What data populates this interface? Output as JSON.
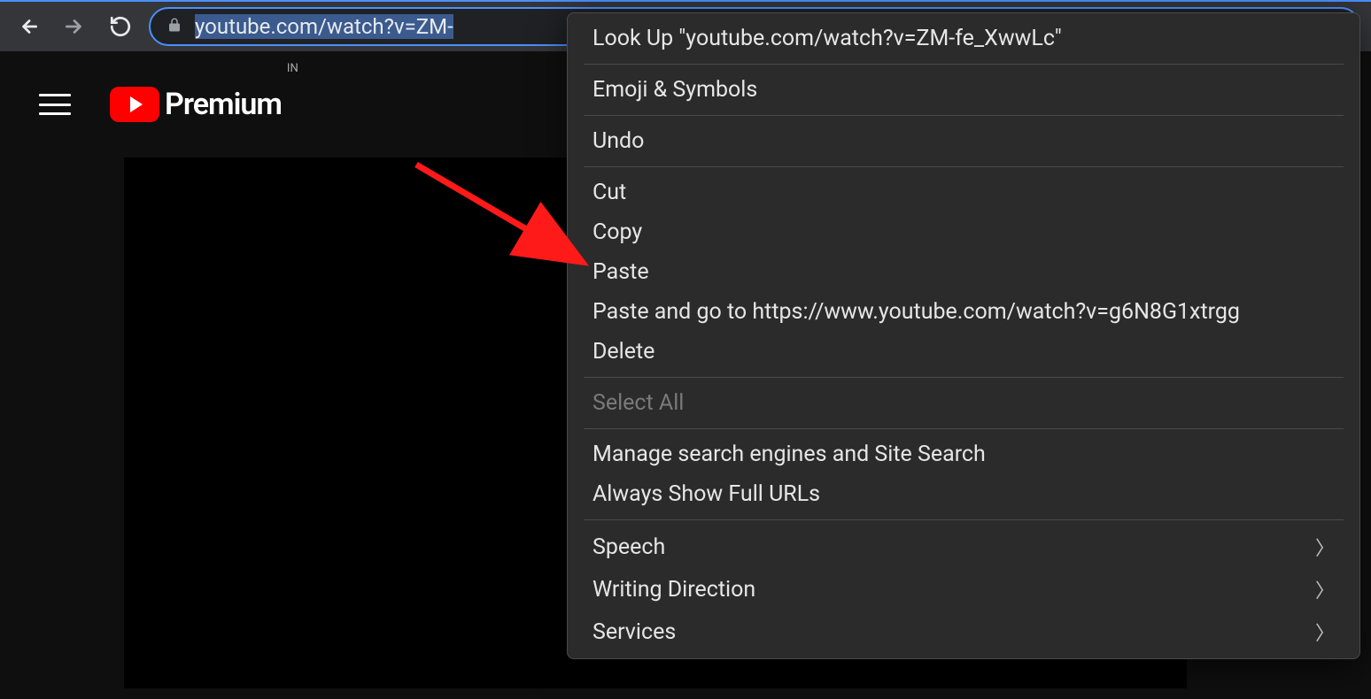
{
  "toolbar": {
    "url_display": "youtube.com/watch?v=ZM-"
  },
  "youtube": {
    "brand_text": "Premium",
    "region": "IN"
  },
  "context_menu": {
    "lookup": "Look Up \"youtube.com/watch?v=ZM-fe_XwwLc\"",
    "emoji": "Emoji & Symbols",
    "undo": "Undo",
    "cut": "Cut",
    "copy": "Copy",
    "paste": "Paste",
    "paste_go": "Paste and go to https://www.youtube.com/watch?v=g6N8G1xtrgg",
    "delete": "Delete",
    "select_all": "Select All",
    "manage_engines": "Manage search engines and Site Search",
    "always_full": "Always Show Full URLs",
    "speech": "Speech",
    "writing_direction": "Writing Direction",
    "services": "Services"
  },
  "colors": {
    "focus_ring": "#4a90ff",
    "youtube_red": "#ff0000",
    "arrow": "#ff1a1a"
  }
}
